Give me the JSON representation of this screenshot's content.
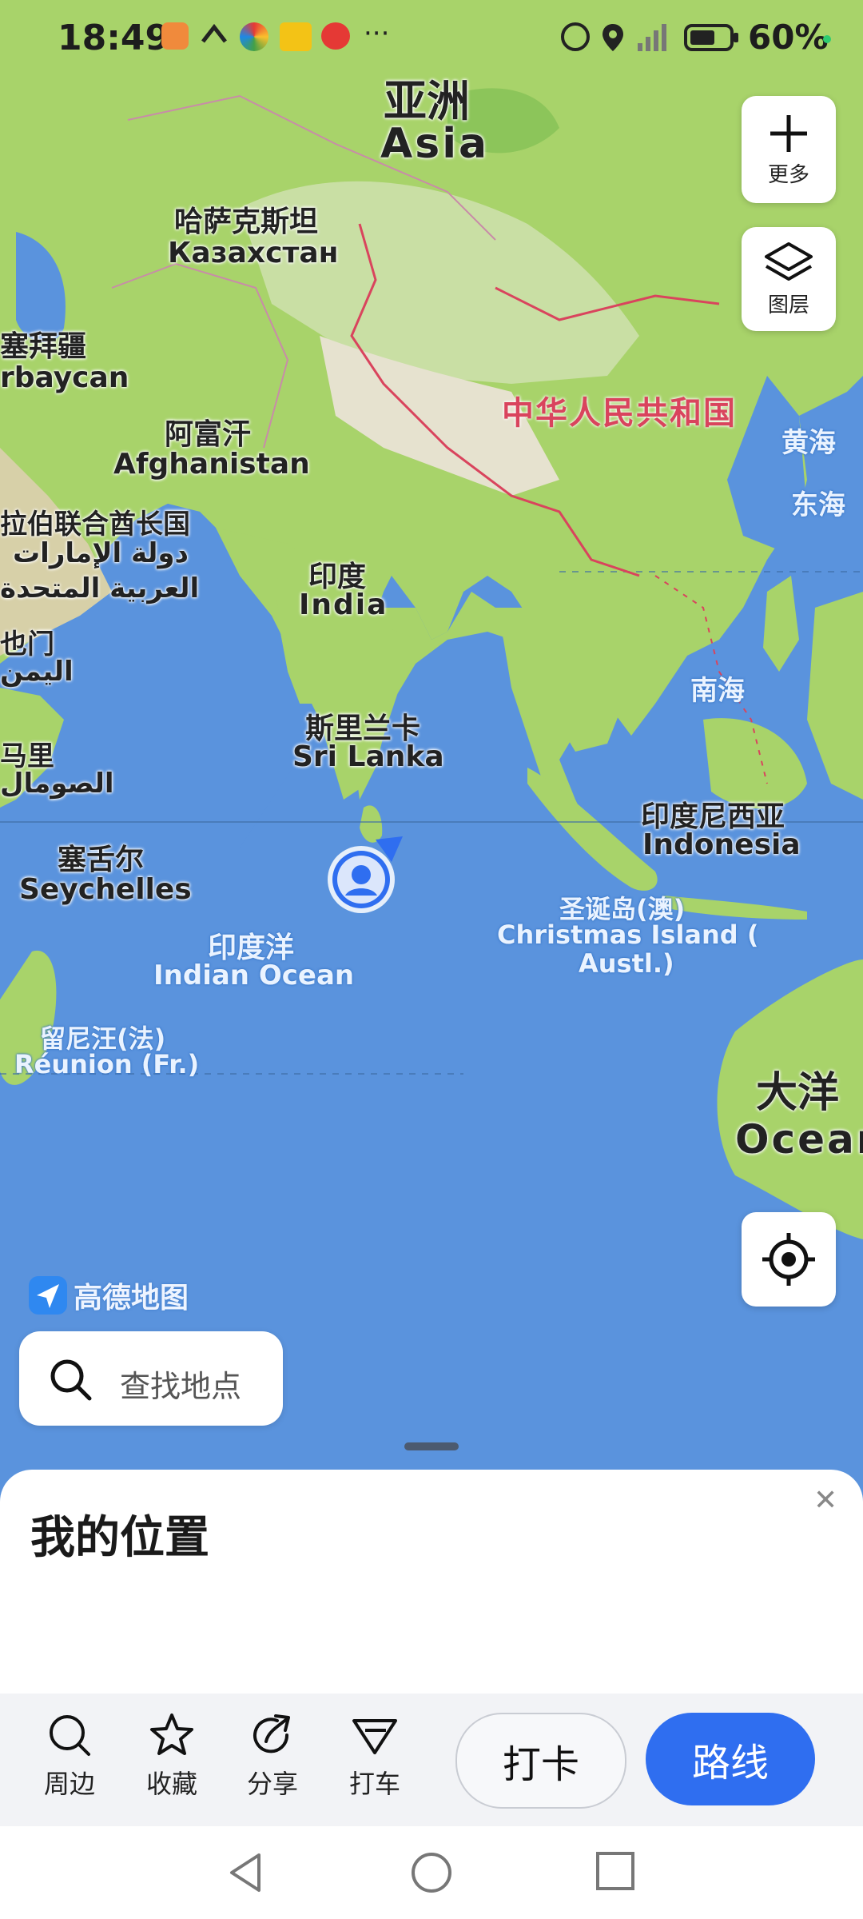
{
  "status_bar": {
    "time": "18:49",
    "battery": "60%"
  },
  "map_controls": {
    "more_label": "更多",
    "layers_label": "图层"
  },
  "map_labels": {
    "asia_zh": "亚洲",
    "asia_en": "Asia",
    "kazakhstan_zh": "哈萨克斯坦",
    "kazakhstan_local": "Казахстан",
    "azerbaijan_zh": "塞拜疆",
    "azerbaijan_en": "rbaycan",
    "afghanistan_zh": "阿富汗",
    "afghanistan_en": "Afghanistan",
    "uae_zh": "拉伯联合酋长国",
    "uae_ar1": "دولة الإمارات",
    "uae_ar2": "العربية المتحدة",
    "yemen_zh": "也门",
    "yemen_ar": "اليمن",
    "somalia_zh": "马里",
    "somalia_ar": "الصومال",
    "china": "中华人民共和国",
    "yellow_sea": "黄海",
    "east_sea": "东海",
    "south_sea": "南海",
    "india_zh": "印度",
    "india_en": "India",
    "srilanka_zh": "斯里兰卡",
    "srilanka_en": "Sri Lanka",
    "indonesia_zh": "印度尼西亚",
    "indonesia_en": "Indonesia",
    "seychelles_zh": "塞舌尔",
    "seychelles_en": "Seychelles",
    "ocean_zh": "印度洋",
    "ocean_en": "Indian Ocean",
    "christmas_zh": "圣诞岛(澳)",
    "christmas_en1": "Christmas Island (",
    "christmas_en2": "Austl.)",
    "reunion_zh": "留尼汪(法)",
    "reunion_en": "Réunion (Fr.)",
    "oceania_zh": "大洋",
    "oceania_en": "Ocean"
  },
  "brand": {
    "logo_text": "高德地图"
  },
  "search": {
    "placeholder": "查找地点",
    "icon": "search-icon"
  },
  "sheet": {
    "title": "我的位置",
    "close": "✕"
  },
  "actions": [
    {
      "label": "周边",
      "icon": "search-icon"
    },
    {
      "label": "收藏",
      "icon": "star-icon"
    },
    {
      "label": "分享",
      "icon": "share-icon"
    },
    {
      "label": "打车",
      "icon": "taxi-icon"
    }
  ],
  "buttons": {
    "checkin": "打卡",
    "route": "路线"
  },
  "colors": {
    "accent": "#2f6ef0",
    "border_line": "#d9445d",
    "ocean": "#5a93dd",
    "land": "#a8d36a"
  }
}
